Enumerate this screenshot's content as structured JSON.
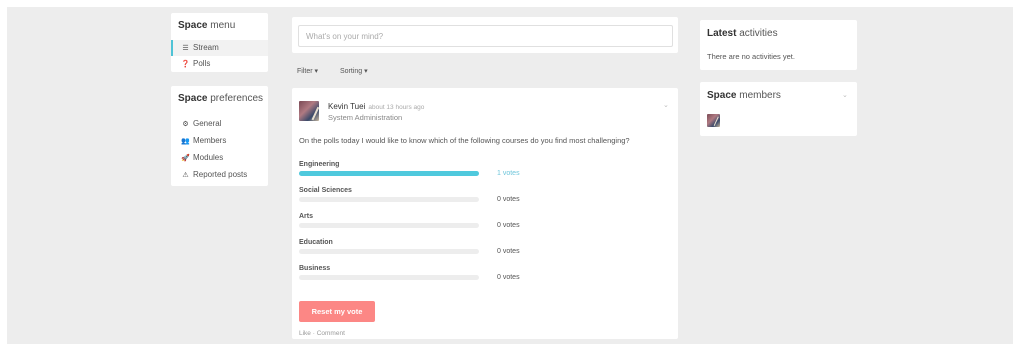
{
  "left_menu": {
    "title_bold": "Space",
    "title_rest": " menu",
    "items": [
      {
        "label": "Stream",
        "icon": "list-icon",
        "glyph": "☰"
      },
      {
        "label": "Polls",
        "icon": "question-circle-icon",
        "glyph": "❓"
      }
    ]
  },
  "preferences": {
    "title_bold": "Space",
    "title_rest": " preferences",
    "items": [
      {
        "label": "General",
        "icon": "cogs-icon",
        "glyph": "⚙"
      },
      {
        "label": "Members",
        "icon": "users-icon",
        "glyph": "👥"
      },
      {
        "label": "Modules",
        "icon": "rocket-icon",
        "glyph": "🚀"
      },
      {
        "label": "Reported posts",
        "icon": "warning-icon",
        "glyph": "⚠"
      }
    ]
  },
  "composer": {
    "placeholder": "What's on your mind?"
  },
  "toolbar": {
    "filter": "Filter ▾",
    "sorting": "Sorting ▾"
  },
  "post": {
    "author": "Kevin Tuei",
    "time": "about 13 hours ago",
    "space": "System Administration",
    "chevron": "⌄",
    "question": "On the polls today I would like to know which of the following courses do you find most challenging?",
    "options": [
      {
        "label": "Engineering",
        "votes": "1 votes",
        "share": 1.0
      },
      {
        "label": "Social Sciences",
        "votes": "0 votes",
        "share": 0
      },
      {
        "label": "Arts",
        "votes": "0 votes",
        "share": 0
      },
      {
        "label": "Education",
        "votes": "0 votes",
        "share": 0
      },
      {
        "label": "Business",
        "votes": "0 votes",
        "share": 0
      }
    ],
    "reset_label": "Reset my vote",
    "actions": "Like · Comment"
  },
  "latest": {
    "title_bold": "Latest",
    "title_rest": " activities",
    "empty": "There are no activities yet."
  },
  "members": {
    "title_bold": "Space",
    "title_rest": " members",
    "chevron": "⌄"
  },
  "colors": {
    "accent": "#4fc9dd",
    "reset": "#fc8785",
    "background": "#ededed"
  }
}
